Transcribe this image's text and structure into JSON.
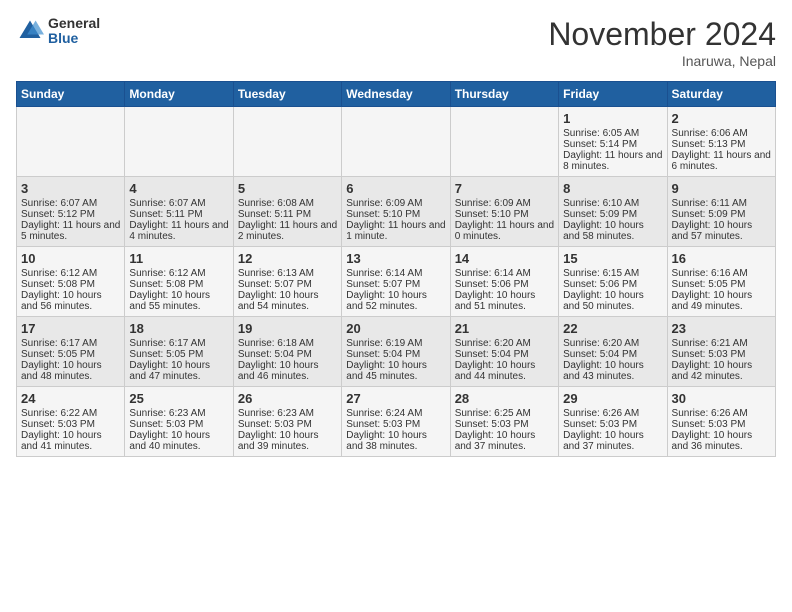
{
  "header": {
    "logo_general": "General",
    "logo_blue": "Blue",
    "month_title": "November 2024",
    "location": "Inaruwa, Nepal"
  },
  "days_of_week": [
    "Sunday",
    "Monday",
    "Tuesday",
    "Wednesday",
    "Thursday",
    "Friday",
    "Saturday"
  ],
  "weeks": [
    [
      {
        "day": "",
        "content": ""
      },
      {
        "day": "",
        "content": ""
      },
      {
        "day": "",
        "content": ""
      },
      {
        "day": "",
        "content": ""
      },
      {
        "day": "",
        "content": ""
      },
      {
        "day": "1",
        "content": "Sunrise: 6:05 AM\nSunset: 5:14 PM\nDaylight: 11 hours and 8 minutes."
      },
      {
        "day": "2",
        "content": "Sunrise: 6:06 AM\nSunset: 5:13 PM\nDaylight: 11 hours and 6 minutes."
      }
    ],
    [
      {
        "day": "3",
        "content": "Sunrise: 6:07 AM\nSunset: 5:12 PM\nDaylight: 11 hours and 5 minutes."
      },
      {
        "day": "4",
        "content": "Sunrise: 6:07 AM\nSunset: 5:11 PM\nDaylight: 11 hours and 4 minutes."
      },
      {
        "day": "5",
        "content": "Sunrise: 6:08 AM\nSunset: 5:11 PM\nDaylight: 11 hours and 2 minutes."
      },
      {
        "day": "6",
        "content": "Sunrise: 6:09 AM\nSunset: 5:10 PM\nDaylight: 11 hours and 1 minute."
      },
      {
        "day": "7",
        "content": "Sunrise: 6:09 AM\nSunset: 5:10 PM\nDaylight: 11 hours and 0 minutes."
      },
      {
        "day": "8",
        "content": "Sunrise: 6:10 AM\nSunset: 5:09 PM\nDaylight: 10 hours and 58 minutes."
      },
      {
        "day": "9",
        "content": "Sunrise: 6:11 AM\nSunset: 5:09 PM\nDaylight: 10 hours and 57 minutes."
      }
    ],
    [
      {
        "day": "10",
        "content": "Sunrise: 6:12 AM\nSunset: 5:08 PM\nDaylight: 10 hours and 56 minutes."
      },
      {
        "day": "11",
        "content": "Sunrise: 6:12 AM\nSunset: 5:08 PM\nDaylight: 10 hours and 55 minutes."
      },
      {
        "day": "12",
        "content": "Sunrise: 6:13 AM\nSunset: 5:07 PM\nDaylight: 10 hours and 54 minutes."
      },
      {
        "day": "13",
        "content": "Sunrise: 6:14 AM\nSunset: 5:07 PM\nDaylight: 10 hours and 52 minutes."
      },
      {
        "day": "14",
        "content": "Sunrise: 6:14 AM\nSunset: 5:06 PM\nDaylight: 10 hours and 51 minutes."
      },
      {
        "day": "15",
        "content": "Sunrise: 6:15 AM\nSunset: 5:06 PM\nDaylight: 10 hours and 50 minutes."
      },
      {
        "day": "16",
        "content": "Sunrise: 6:16 AM\nSunset: 5:05 PM\nDaylight: 10 hours and 49 minutes."
      }
    ],
    [
      {
        "day": "17",
        "content": "Sunrise: 6:17 AM\nSunset: 5:05 PM\nDaylight: 10 hours and 48 minutes."
      },
      {
        "day": "18",
        "content": "Sunrise: 6:17 AM\nSunset: 5:05 PM\nDaylight: 10 hours and 47 minutes."
      },
      {
        "day": "19",
        "content": "Sunrise: 6:18 AM\nSunset: 5:04 PM\nDaylight: 10 hours and 46 minutes."
      },
      {
        "day": "20",
        "content": "Sunrise: 6:19 AM\nSunset: 5:04 PM\nDaylight: 10 hours and 45 minutes."
      },
      {
        "day": "21",
        "content": "Sunrise: 6:20 AM\nSunset: 5:04 PM\nDaylight: 10 hours and 44 minutes."
      },
      {
        "day": "22",
        "content": "Sunrise: 6:20 AM\nSunset: 5:04 PM\nDaylight: 10 hours and 43 minutes."
      },
      {
        "day": "23",
        "content": "Sunrise: 6:21 AM\nSunset: 5:03 PM\nDaylight: 10 hours and 42 minutes."
      }
    ],
    [
      {
        "day": "24",
        "content": "Sunrise: 6:22 AM\nSunset: 5:03 PM\nDaylight: 10 hours and 41 minutes."
      },
      {
        "day": "25",
        "content": "Sunrise: 6:23 AM\nSunset: 5:03 PM\nDaylight: 10 hours and 40 minutes."
      },
      {
        "day": "26",
        "content": "Sunrise: 6:23 AM\nSunset: 5:03 PM\nDaylight: 10 hours and 39 minutes."
      },
      {
        "day": "27",
        "content": "Sunrise: 6:24 AM\nSunset: 5:03 PM\nDaylight: 10 hours and 38 minutes."
      },
      {
        "day": "28",
        "content": "Sunrise: 6:25 AM\nSunset: 5:03 PM\nDaylight: 10 hours and 37 minutes."
      },
      {
        "day": "29",
        "content": "Sunrise: 6:26 AM\nSunset: 5:03 PM\nDaylight: 10 hours and 37 minutes."
      },
      {
        "day": "30",
        "content": "Sunrise: 6:26 AM\nSunset: 5:03 PM\nDaylight: 10 hours and 36 minutes."
      }
    ]
  ]
}
